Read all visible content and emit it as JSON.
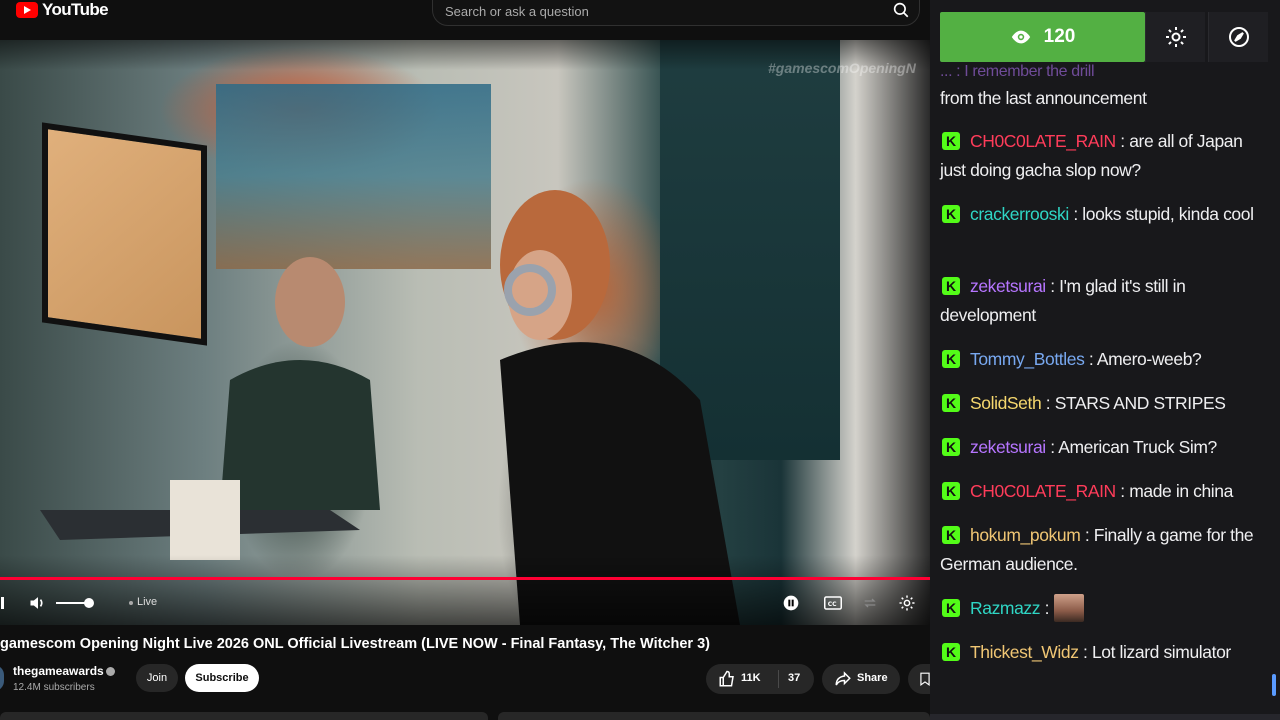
{
  "header": {
    "logo_text": "YouTube",
    "search_placeholder": "Search or ask a question"
  },
  "video": {
    "overlay_hashtag": "#gamescomOpeningN",
    "live_label": "Live",
    "progress": 1.0,
    "volume": 0.8
  },
  "info": {
    "title": "gamescom Opening Night Live 2026 ONL Official Livestream (LIVE NOW - Final Fantasy, The Witcher 3)",
    "channel_name": "thegameawards",
    "subscribers": "12.4M subscribers",
    "join_label": "Join",
    "subscribe_label": "Subscribe",
    "likes": "11K",
    "dislikes_or_count": "37",
    "share_label": "Share"
  },
  "chat": {
    "viewer_count": "120",
    "accent_green": "#53b043",
    "messages": [
      {
        "user": "",
        "user_color": "#9147ff",
        "text": "from the last announcement",
        "badge": false
      },
      {
        "user": "CH0C0LATE_RAIN",
        "user_color": "#ff3c5a",
        "text": "are all of Japan just doing gacha slop now?",
        "badge": true
      },
      {
        "user": "crackerrooski",
        "user_color": "#2fd6c5",
        "text": "looks stupid, kinda cool",
        "badge": true
      },
      {
        "user": "zeketsurai",
        "user_color": "#b675ff",
        "text": "I'm glad it's still in development",
        "badge": true
      },
      {
        "user": "Tommy_Bottles",
        "user_color": "#78a8f0",
        "text": "Amero-weeb?",
        "badge": true
      },
      {
        "user": "SolidSeth",
        "user_color": "#f5d76e",
        "text": "STARS AND STRIPES",
        "badge": true
      },
      {
        "user": "zeketsurai",
        "user_color": "#b675ff",
        "text": "American Truck Sim?",
        "badge": true
      },
      {
        "user": "CH0C0LATE_RAIN",
        "user_color": "#ff3c5a",
        "text": "made in china",
        "badge": true
      },
      {
        "user": "hokum_pokum",
        "user_color": "#f0c674",
        "text": "Finally a game for the German audience.",
        "badge": true
      },
      {
        "user": "Razmazz",
        "user_color": "#2fd6c5",
        "text": "",
        "badge": true,
        "emote": true
      },
      {
        "user": "Thickest_Widz",
        "user_color": "#f0c674",
        "text": "Lot lizard simulator",
        "badge": true
      }
    ]
  }
}
